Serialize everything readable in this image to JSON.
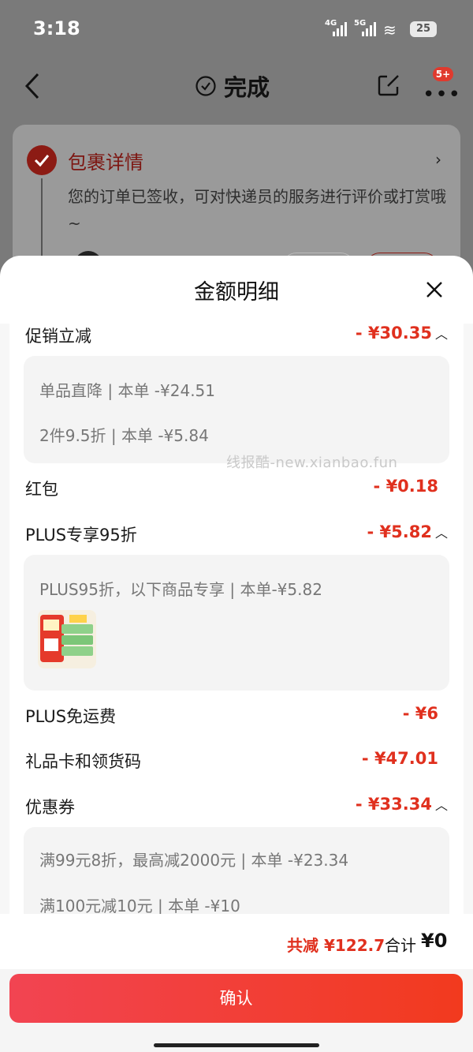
{
  "status_bar": {
    "time": "3:18",
    "net1": "4G",
    "net2": "5G",
    "battery": "25"
  },
  "top_bar": {
    "title": "完成",
    "badge": "5+"
  },
  "package": {
    "title": "包裹详情",
    "text": "您的订单已签收，可对快递员的服务进行评价或打赏哦~"
  },
  "sheet": {
    "title": "金额明细",
    "rows": [
      {
        "label": "促销立减",
        "amount": "- ¥30.35"
      },
      {
        "label": "红包",
        "amount": "- ¥0.18"
      },
      {
        "label": "PLUS专享95折",
        "amount": "- ¥5.82"
      },
      {
        "label": "PLUS免运费",
        "amount": "- ¥6"
      },
      {
        "label": "礼品卡和领货码",
        "amount": "- ¥47.01"
      },
      {
        "label": "优惠券",
        "amount": "- ¥33.34"
      }
    ],
    "promo_details": [
      "单品直降 | 本单 -¥24.51",
      "2件9.5折 | 本单 -¥5.84"
    ],
    "plus_detail": "PLUS95折，以下商品专享 | 本单-¥5.82",
    "coupon_details": [
      "满99元8折，最高减2000元 | 本单 -¥23.34",
      "满100元减10元 | 本单 -¥10"
    ],
    "watermark": "线报酷-new.xianbao.fun",
    "total_reduce": "共减 ¥122.7",
    "total_label": "合计",
    "total_value": "¥0",
    "confirm_label": "确认"
  },
  "colors": {
    "accent": "#e0301e",
    "button": "#f2403a"
  }
}
